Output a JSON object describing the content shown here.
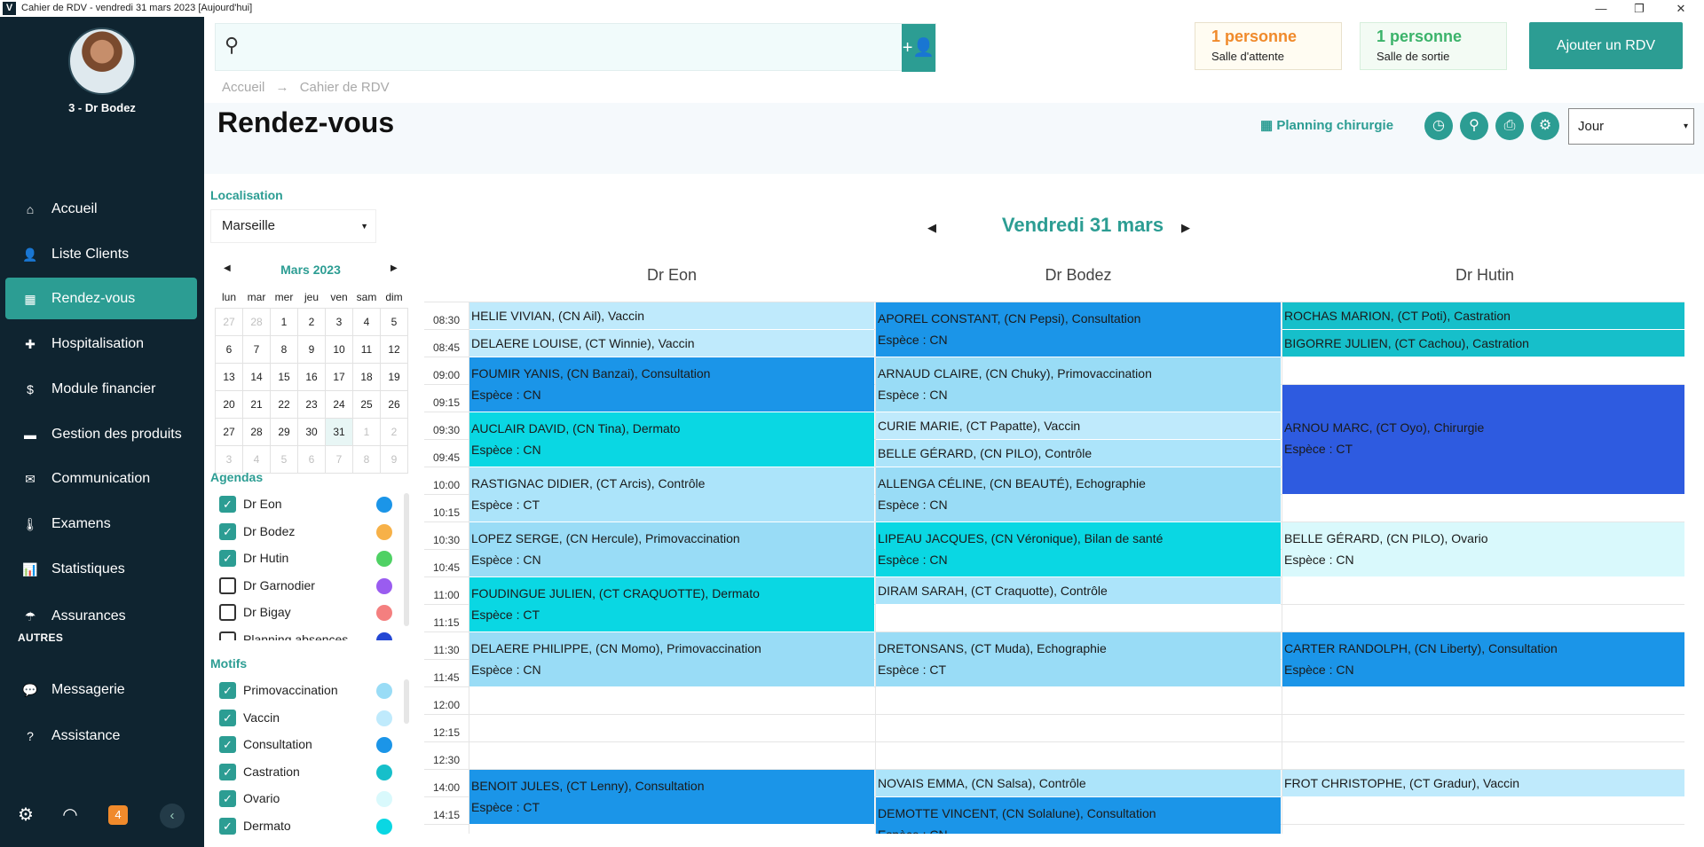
{
  "window": {
    "title": "Cahier de RDV - vendredi 31 mars 2023 [Aujourd'hui]",
    "logo": "V",
    "controls": [
      "—",
      "❐",
      "✕"
    ]
  },
  "sidebar": {
    "user": "3 - Dr Bodez",
    "items": [
      {
        "label": "Accueil",
        "icon": "⌂"
      },
      {
        "label": "Liste Clients",
        "icon": "👤"
      },
      {
        "label": "Rendez-vous",
        "icon": "▦"
      },
      {
        "label": "Hospitalisation",
        "icon": "✚"
      },
      {
        "label": "Module financier",
        "icon": "$"
      },
      {
        "label": "Gestion des produits",
        "icon": "▬"
      },
      {
        "label": "Communication",
        "icon": "✉"
      },
      {
        "label": "Examens",
        "icon": "🌡"
      },
      {
        "label": "Statistiques",
        "icon": "📊"
      },
      {
        "label": "Assurances",
        "icon": "☂"
      }
    ],
    "section_autres": "AUTRES",
    "other_items": [
      {
        "label": "Messagerie",
        "icon": "💬"
      },
      {
        "label": "Assistance",
        "icon": "?"
      }
    ],
    "footer": {
      "settings_icon": "⚙",
      "feed_icon": "◠",
      "badge": "4",
      "collapse": "‹"
    }
  },
  "header": {
    "search_icon": "⚲",
    "add_client_icon": "+👤",
    "waiting": {
      "count": "1 personne",
      "label": "Salle d'attente",
      "color": "#f08a2b"
    },
    "exit": {
      "count": "1 personne",
      "label": "Salle de sortie",
      "color": "#3bb36a"
    },
    "add_rdv": "Ajouter un RDV"
  },
  "breadcrumb": {
    "home": "Accueil",
    "sep": "→",
    "current": "Cahier de RDV"
  },
  "page": {
    "title": "Rendez-vous",
    "planning": "Planning chirurgie",
    "planning_icon": "▦",
    "toolbar_icons": [
      "◷",
      "⚲",
      "⎙",
      "⚙"
    ],
    "view": "Jour"
  },
  "left": {
    "loc_label": "Localisation",
    "loc_value": "Marseille",
    "calendar": {
      "month": "Mars 2023",
      "days": [
        "lun",
        "mar",
        "mer",
        "jeu",
        "ven",
        "sam",
        "dim"
      ],
      "weeks": [
        [
          "27",
          "28",
          "1",
          "2",
          "3",
          "4",
          "5"
        ],
        [
          "6",
          "7",
          "8",
          "9",
          "10",
          "11",
          "12"
        ],
        [
          "13",
          "14",
          "15",
          "16",
          "17",
          "18",
          "19"
        ],
        [
          "20",
          "21",
          "22",
          "23",
          "24",
          "25",
          "26"
        ],
        [
          "27",
          "28",
          "29",
          "30",
          "31",
          "1",
          "2"
        ],
        [
          "3",
          "4",
          "5",
          "6",
          "7",
          "8",
          "9"
        ]
      ]
    },
    "agendas_label": "Agendas",
    "agendas": [
      {
        "label": "Dr Eon",
        "checked": true,
        "color": "#1b95e8"
      },
      {
        "label": "Dr Bodez",
        "checked": true,
        "color": "#f7b148"
      },
      {
        "label": "Dr Hutin",
        "checked": true,
        "color": "#4fd164"
      },
      {
        "label": "Dr Garnodier",
        "checked": false,
        "color": "#9a5cf0"
      },
      {
        "label": "Dr Bigay",
        "checked": false,
        "color": "#f47f7f"
      },
      {
        "label": "Planning absences",
        "checked": false,
        "color": "#2347d4"
      }
    ],
    "motifs_label": "Motifs",
    "motifs": [
      {
        "label": "Primovaccination",
        "checked": true,
        "color": "#99dcf6"
      },
      {
        "label": "Vaccin",
        "checked": true,
        "color": "#bfeafc"
      },
      {
        "label": "Consultation",
        "checked": true,
        "color": "#1b95e8"
      },
      {
        "label": "Castration",
        "checked": true,
        "color": "#16bfca"
      },
      {
        "label": "Ovario",
        "checked": true,
        "color": "#d9f9fc"
      },
      {
        "label": "Dermato",
        "checked": true,
        "color": "#0ad7e3"
      }
    ]
  },
  "schedule": {
    "day": "Vendredi 31 mars",
    "columns": [
      "Dr Eon",
      "Dr Bodez",
      "Dr Hutin"
    ],
    "times": [
      "08:30",
      "08:45",
      "09:00",
      "09:15",
      "09:30",
      "09:45",
      "10:00",
      "10:15",
      "10:30",
      "10:45",
      "11:00",
      "11:15",
      "11:30",
      "11:45",
      "12:00",
      "12:15",
      "12:30",
      "14:00",
      "14:15"
    ],
    "appointments": [
      {
        "col": 0,
        "start": 0,
        "span": 1,
        "text": "HELIE VIVIAN, (CN Ail), Vaccin",
        "sub": "",
        "color": "#bfeafc"
      },
      {
        "col": 0,
        "start": 1,
        "span": 1,
        "text": "DELAERE LOUISE, (CT Winnie), Vaccin",
        "sub": "",
        "color": "#bfeafc"
      },
      {
        "col": 0,
        "start": 2,
        "span": 2,
        "text": "FOUMIR YANIS, (CN Banzai), Consultation",
        "sub": "Espèce : CN",
        "color": "#1b95e8"
      },
      {
        "col": 0,
        "start": 4,
        "span": 2,
        "text": "AUCLAIR DAVID, (CN Tina), Dermato",
        "sub": "Espèce : CN",
        "color": "#0ad7e3"
      },
      {
        "col": 0,
        "start": 6,
        "span": 2,
        "text": "RASTIGNAC DIDIER, (CT Arcis), Contrôle",
        "sub": "Espèce : CT",
        "color": "#ace4fa"
      },
      {
        "col": 0,
        "start": 8,
        "span": 2,
        "text": "LOPEZ SERGE, (CN Hercule), Primovaccination",
        "sub": "Espèce : CN",
        "color": "#99dcf6"
      },
      {
        "col": 0,
        "start": 10,
        "span": 2,
        "text": "FOUDINGUE JULIEN, (CT CRAQUOTTE), Dermato",
        "sub": "Espèce : CT",
        "color": "#0ad7e3"
      },
      {
        "col": 0,
        "start": 12,
        "span": 2,
        "text": "DELAERE PHILIPPE, (CN Momo), Primovaccination",
        "sub": "Espèce : CN",
        "color": "#99dcf6"
      },
      {
        "col": 0,
        "start": 17,
        "span": 2,
        "text": "BENOIT JULES, (CT Lenny), Consultation",
        "sub": "Espèce : CT",
        "color": "#1b95e8"
      },
      {
        "col": 1,
        "start": 0,
        "span": 2,
        "text": "APOREL CONSTANT, (CN Pepsi), Consultation",
        "sub": "Espèce : CN",
        "color": "#1b95e8"
      },
      {
        "col": 1,
        "start": 2,
        "span": 2,
        "text": "ARNAUD CLAIRE, (CN Chuky), Primovaccination",
        "sub": "Espèce : CN",
        "color": "#99dcf6"
      },
      {
        "col": 1,
        "start": 4,
        "span": 1,
        "text": "CURIE MARIE, (CT Papatte), Vaccin",
        "sub": "",
        "color": "#bfeafc"
      },
      {
        "col": 1,
        "start": 5,
        "span": 1,
        "text": "BELLE GÉRARD, (CN PILO), Contrôle",
        "sub": "",
        "color": "#ace4fa"
      },
      {
        "col": 1,
        "start": 6,
        "span": 2,
        "text": "ALLENGA CÉLINE, (CN BEAUTÉ), Echographie",
        "sub": "Espèce : CN",
        "color": "#99dcf6"
      },
      {
        "col": 1,
        "start": 8,
        "span": 2,
        "text": "LIPEAU JACQUES, (CN Véronique), Bilan de santé",
        "sub": "Espèce : CN",
        "color": "#0ad7e3"
      },
      {
        "col": 1,
        "start": 10,
        "span": 1,
        "text": "DIRAM SARAH, (CT Craquotte), Contrôle",
        "sub": "",
        "color": "#ace4fa"
      },
      {
        "col": 1,
        "start": 12,
        "span": 2,
        "text": "DRETONSANS, (CT Muda), Echographie",
        "sub": "Espèce : CT",
        "color": "#99dcf6"
      },
      {
        "col": 1,
        "start": 17,
        "span": 1,
        "text": "NOVAIS EMMA, (CN Salsa), Contrôle",
        "sub": "",
        "color": "#ace4fa"
      },
      {
        "col": 1,
        "start": 18,
        "span": 2,
        "text": "DEMOTTE VINCENT, (CN Solalune), Consultation",
        "sub": "Espèce : CN",
        "color": "#1b95e8"
      },
      {
        "col": 2,
        "start": 0,
        "span": 1,
        "text": "ROCHAS MARION, (CT Poti), Castration",
        "sub": "",
        "color": "#16bfca"
      },
      {
        "col": 2,
        "start": 1,
        "span": 1,
        "text": "BIGORRE JULIEN, (CT Cachou), Castration",
        "sub": "",
        "color": "#16bfca"
      },
      {
        "col": 2,
        "start": 3,
        "span": 4,
        "text": "ARNOU MARC, (CT Oyo), Chirurgie",
        "sub": "Espèce : CT",
        "color": "#2e5be0"
      },
      {
        "col": 2,
        "start": 8,
        "span": 2,
        "text": "BELLE GÉRARD, (CN PILO), Ovario",
        "sub": "Espèce : CN",
        "color": "#d9f9fc"
      },
      {
        "col": 2,
        "start": 12,
        "span": 2,
        "text": "CARTER RANDOLPH, (CN Liberty), Consultation",
        "sub": "Espèce : CN",
        "color": "#1b95e8"
      },
      {
        "col": 2,
        "start": 17,
        "span": 1,
        "text": "FROT CHRISTOPHE, (CT Gradur), Vaccin",
        "sub": "",
        "color": "#bfeafc"
      }
    ]
  }
}
